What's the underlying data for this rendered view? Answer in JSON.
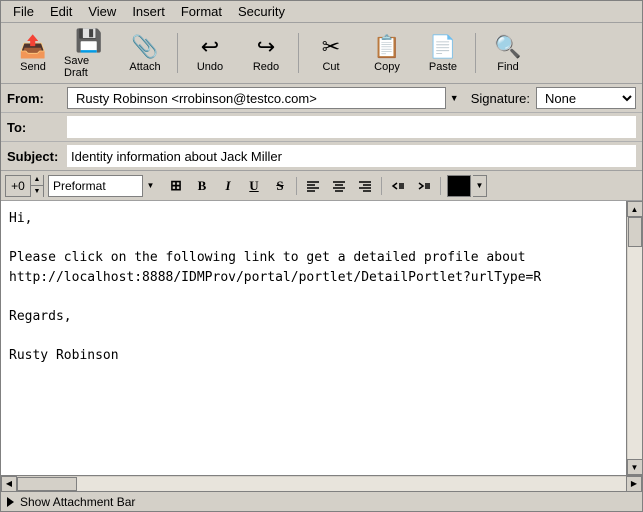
{
  "menubar": {
    "items": [
      "File",
      "Edit",
      "View",
      "Insert",
      "Format",
      "Security"
    ]
  },
  "toolbar": {
    "buttons": [
      {
        "id": "send",
        "label": "Send",
        "icon": "📤"
      },
      {
        "id": "save-draft",
        "label": "Save Draft",
        "icon": "💾"
      },
      {
        "id": "attach",
        "label": "Attach",
        "icon": "📎"
      },
      {
        "id": "undo",
        "label": "Undo",
        "icon": "↩"
      },
      {
        "id": "redo",
        "label": "Redo",
        "icon": "↪"
      },
      {
        "id": "cut",
        "label": "Cut",
        "icon": "✂"
      },
      {
        "id": "copy",
        "label": "Copy",
        "icon": "📋"
      },
      {
        "id": "paste",
        "label": "Paste",
        "icon": "📄"
      },
      {
        "id": "find",
        "label": "Find",
        "icon": "🔍"
      }
    ]
  },
  "header": {
    "from_label": "From:",
    "from_value": "Rusty Robinson <rrobinson@testco.com>",
    "signature_label": "Signature:",
    "signature_value": "None",
    "to_label": "To:",
    "to_value": "",
    "subject_label": "Subject:",
    "subject_value": "Identity information about Jack Miller"
  },
  "format_toolbar": {
    "size_value": "+0",
    "font_value": "Preformat",
    "buttons": [
      {
        "id": "insert-table",
        "icon": "⊞",
        "label": "Insert Table"
      },
      {
        "id": "bold",
        "icon": "B",
        "label": "Bold"
      },
      {
        "id": "italic",
        "icon": "I",
        "label": "Italic"
      },
      {
        "id": "underline",
        "icon": "U",
        "label": "Underline"
      },
      {
        "id": "strikethrough",
        "icon": "S",
        "label": "Strikethrough"
      }
    ],
    "align_buttons": [
      {
        "id": "align-left",
        "icon": "≡",
        "label": "Align Left"
      },
      {
        "id": "align-center",
        "icon": "≡",
        "label": "Align Center"
      },
      {
        "id": "align-right",
        "icon": "≡",
        "label": "Align Right"
      },
      {
        "id": "indent-left",
        "icon": "◂",
        "label": "Decrease Indent"
      },
      {
        "id": "indent-right",
        "icon": "▸",
        "label": "Increase Indent"
      }
    ],
    "color_value": "#000000"
  },
  "body": {
    "content": "Hi,\n\nPlease click on the following link to get a detailed profile about \nhttp://localhost:8888/IDMProv/portal/portlet/DetailPortlet?urlType=R\n\nRegards,\n\nRusty Robinson"
  },
  "attachment_bar": {
    "label": "Show Attachment Bar"
  }
}
